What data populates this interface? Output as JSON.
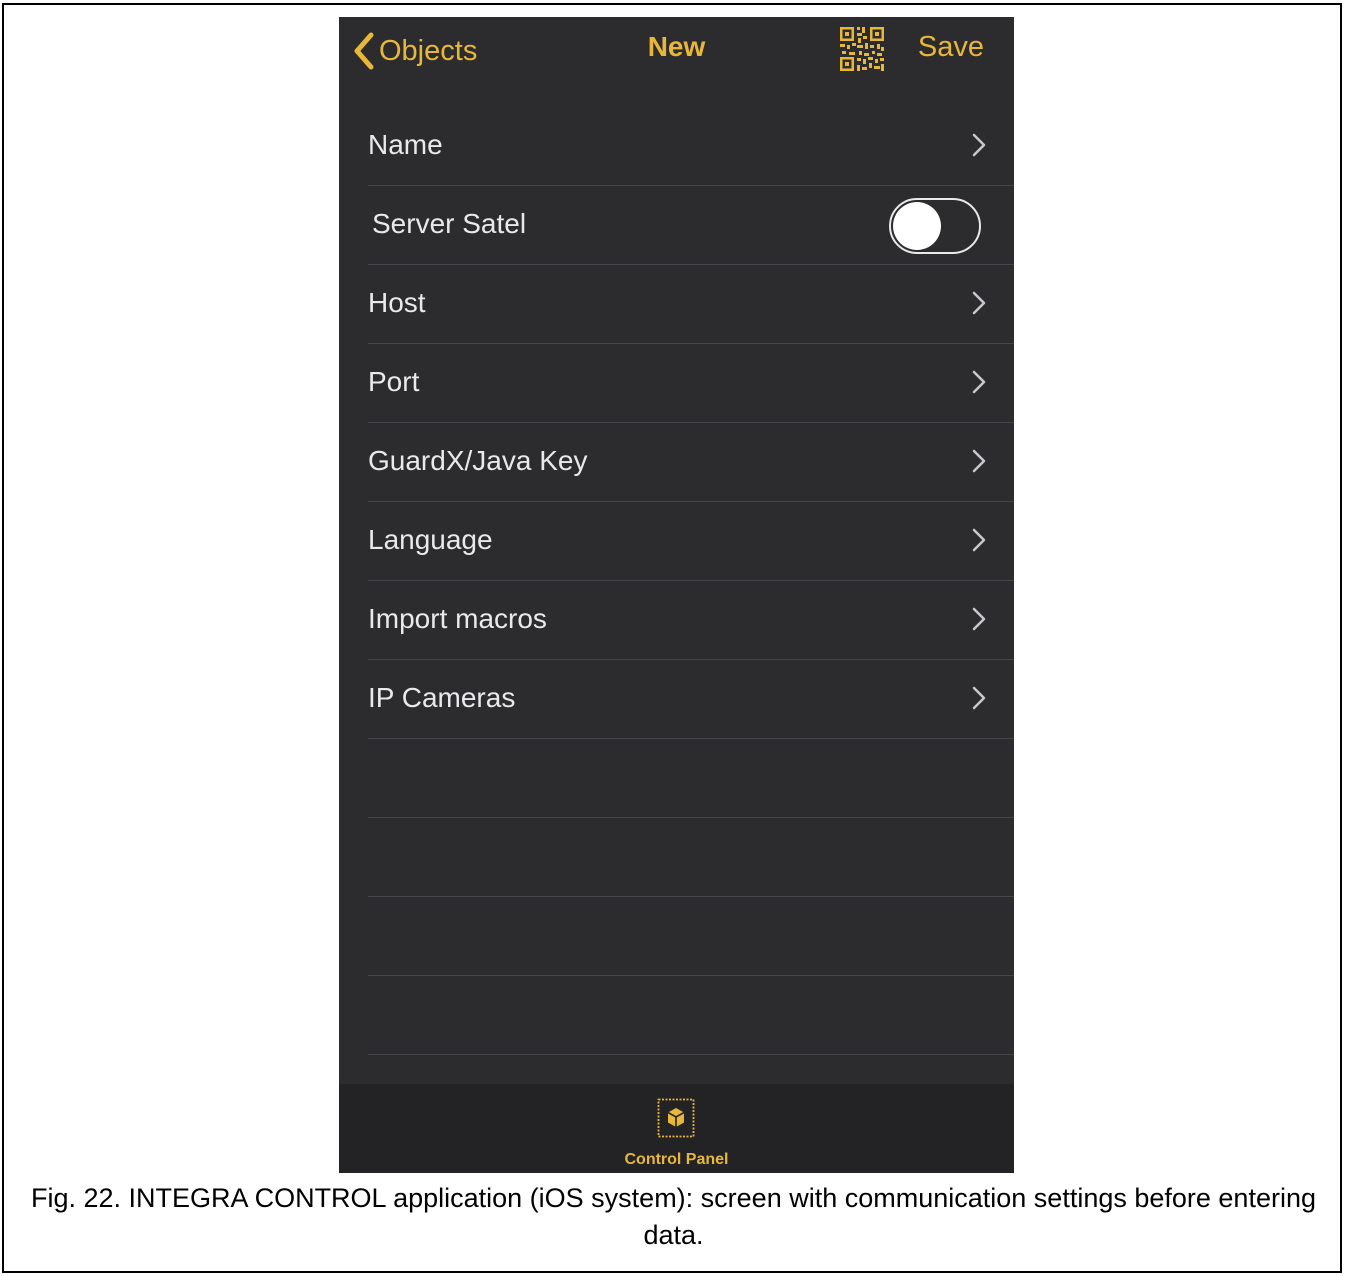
{
  "navbar": {
    "back_label": "Objects",
    "title": "New",
    "qr_icon": "qr-code-icon",
    "save_label": "Save"
  },
  "settings": {
    "items": [
      {
        "label": "Name",
        "type": "chevron"
      },
      {
        "label": "Server Satel",
        "type": "toggle",
        "value": false
      },
      {
        "label": "Host",
        "type": "chevron"
      },
      {
        "label": "Port",
        "type": "chevron"
      },
      {
        "label": "GuardX/Java Key",
        "type": "chevron"
      },
      {
        "label": "Language",
        "type": "chevron"
      },
      {
        "label": "Import macros",
        "type": "chevron"
      },
      {
        "label": "IP Cameras",
        "type": "chevron"
      }
    ]
  },
  "tabbar": {
    "icon": "control-panel-icon",
    "label": "Control Panel"
  },
  "caption": "Fig. 22. INTEGRA CONTROL application (iOS system): screen with communication settings before entering data.",
  "colors": {
    "accent": "#e8b73a",
    "background": "#2c2c2f",
    "text": "#e9e9ec",
    "separator": "#46464a"
  }
}
